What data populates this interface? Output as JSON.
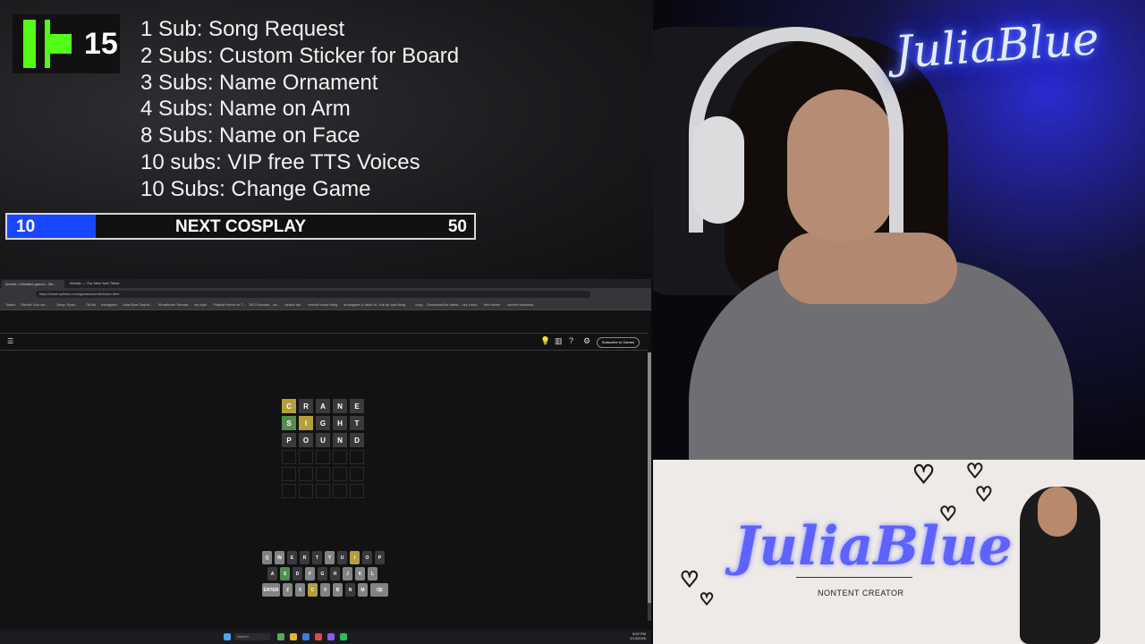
{
  "overlay": {
    "kick_count": "15",
    "goals": [
      "1 Sub: Song Request",
      "2 Subs: Custom Sticker for Board",
      "3 Subs: Name Ornament",
      "4 Subs: Name on Arm",
      "8 Subs: Name on Face",
      "10 subs: VIP free TTS Voices",
      "10 Subs: Change Game"
    ],
    "goal_bar": {
      "current": "10",
      "label": "NEXT COSPLAY",
      "target": "50",
      "progress": 0.19,
      "fill_color": "#1947ff"
    }
  },
  "webcam": {
    "neon_sign": "JuliaBlue"
  },
  "browser": {
    "tabs": [
      "Wordle, Unlimited games - Ne...",
      "Wordle — The New York Times"
    ],
    "url": "https://www.nytimes.com/games/wordle/index.html",
    "bookmarks": [
      "Twitch",
      "Reddit: Doc om ...",
      "Shop: Ryan...",
      "TikTok",
      "Instagram",
      "Julia Blue Dashb...",
      "Whatfinder Stream...",
      "my clips",
      "Playlist Home for T...",
      "SEO Booster - sa...",
      "what's fun",
      "rennell mood thing",
      "showgram & radio hi...",
      "the dir wall thing",
      "copy",
      "Download the latest...",
      "dry rocks",
      "this theme",
      "current business"
    ],
    "nyt": {
      "subscribe_label": "Subscribe to Games",
      "icons": [
        "lightbulb-icon",
        "stats-icon",
        "help-icon",
        "settings-icon"
      ]
    },
    "wordle": {
      "rows": [
        [
          {
            "l": "C",
            "s": "present"
          },
          {
            "l": "R",
            "s": "absent"
          },
          {
            "l": "A",
            "s": "absent"
          },
          {
            "l": "N",
            "s": "absent"
          },
          {
            "l": "E",
            "s": "absent"
          }
        ],
        [
          {
            "l": "S",
            "s": "correct"
          },
          {
            "l": "I",
            "s": "present"
          },
          {
            "l": "G",
            "s": "absent"
          },
          {
            "l": "H",
            "s": "absent"
          },
          {
            "l": "T",
            "s": "absent"
          }
        ],
        [
          {
            "l": "P",
            "s": "absent"
          },
          {
            "l": "O",
            "s": "absent"
          },
          {
            "l": "U",
            "s": "absent"
          },
          {
            "l": "N",
            "s": "absent"
          },
          {
            "l": "D",
            "s": "absent"
          }
        ],
        [
          {
            "l": "",
            "s": "empty"
          },
          {
            "l": "",
            "s": "empty"
          },
          {
            "l": "",
            "s": "empty"
          },
          {
            "l": "",
            "s": "empty"
          },
          {
            "l": "",
            "s": "empty"
          }
        ],
        [
          {
            "l": "",
            "s": "empty"
          },
          {
            "l": "",
            "s": "empty"
          },
          {
            "l": "",
            "s": "empty"
          },
          {
            "l": "",
            "s": "empty"
          },
          {
            "l": "",
            "s": "empty"
          }
        ],
        [
          {
            "l": "",
            "s": "empty"
          },
          {
            "l": "",
            "s": "empty"
          },
          {
            "l": "",
            "s": "empty"
          },
          {
            "l": "",
            "s": "empty"
          },
          {
            "l": "",
            "s": "empty"
          }
        ]
      ],
      "keyboard": [
        [
          {
            "k": "Q",
            "s": "unused"
          },
          {
            "k": "W",
            "s": "unused"
          },
          {
            "k": "E",
            "s": "absent"
          },
          {
            "k": "R",
            "s": "absent"
          },
          {
            "k": "T",
            "s": "absent"
          },
          {
            "k": "Y",
            "s": "unused"
          },
          {
            "k": "U",
            "s": "absent"
          },
          {
            "k": "I",
            "s": "present"
          },
          {
            "k": "O",
            "s": "absent"
          },
          {
            "k": "P",
            "s": "absent"
          }
        ],
        [
          {
            "k": "A",
            "s": "absent"
          },
          {
            "k": "S",
            "s": "correct"
          },
          {
            "k": "D",
            "s": "absent"
          },
          {
            "k": "F",
            "s": "unused"
          },
          {
            "k": "G",
            "s": "absent"
          },
          {
            "k": "H",
            "s": "absent"
          },
          {
            "k": "J",
            "s": "unused"
          },
          {
            "k": "K",
            "s": "unused"
          },
          {
            "k": "L",
            "s": "unused"
          }
        ],
        [
          {
            "k": "ENTER",
            "s": "unused",
            "wide": true
          },
          {
            "k": "Z",
            "s": "unused"
          },
          {
            "k": "X",
            "s": "unused"
          },
          {
            "k": "C",
            "s": "present"
          },
          {
            "k": "V",
            "s": "unused"
          },
          {
            "k": "B",
            "s": "unused"
          },
          {
            "k": "N",
            "s": "absent"
          },
          {
            "k": "M",
            "s": "unused"
          },
          {
            "k": "⌫",
            "s": "unused",
            "wide": true
          }
        ]
      ]
    },
    "taskbar": {
      "search_placeholder": "Search",
      "time": "6:52 PM",
      "date": "2/13/2026"
    }
  },
  "banner": {
    "logo": "JuliaBlue",
    "tagline": "NONTENT CREATOR"
  }
}
